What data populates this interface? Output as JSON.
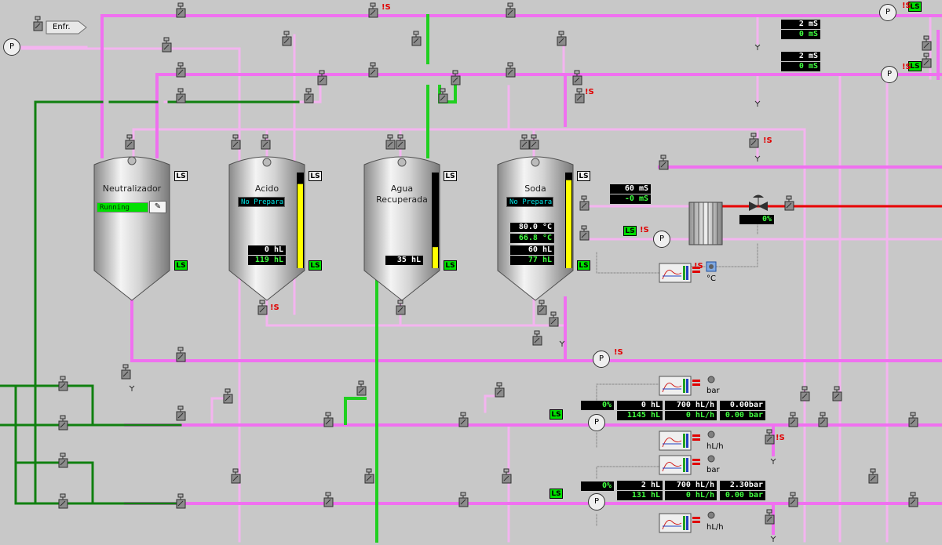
{
  "header": {
    "button_label": "Enfr."
  },
  "tanks": [
    {
      "name": "Neutralizador",
      "status": "Running"
    },
    {
      "name": "Acido",
      "status": "No Prepara",
      "volume": "0 hL",
      "capacity": "119 hL",
      "level": 0.88
    },
    {
      "name": "Agua\nRecuperada",
      "line1": "Agua",
      "line2": "Recuperada",
      "volume": "35 hL",
      "level": 0.22
    },
    {
      "name": "Soda",
      "status": "No Prepara",
      "temp_set": "80.0 °C",
      "temp_actual": "66.8 °C",
      "volume": "60 hL",
      "capacity": "77 hL",
      "level": 0.92
    }
  ],
  "ls_label": "LS",
  "alarm_label": "!S",
  "pump_label": "P",
  "conductivity": {
    "top1_set": "2 mS",
    "top1_actual": "0 mS",
    "top2_set": "2 mS",
    "top2_actual": "0 mS",
    "soda_set": "60 mS",
    "soda_actual": "-0 mS"
  },
  "valve_opening": "0%",
  "temp_unit": "°C",
  "line1": {
    "pump_pct": "0%",
    "volume": "0 hL",
    "volume_total": "1145 hL",
    "flow_set": "700 hL/h",
    "flow_actual": "0 hL/h",
    "pressure_set": "0.00bar",
    "pressure_actual": "0.00 bar",
    "unit_pressure": "bar",
    "unit_flow": "hL/h"
  },
  "line2": {
    "pump_pct": "0%",
    "volume": "2 hL",
    "volume_total": "131 hL",
    "flow_set": "700 hL/h",
    "flow_actual": "0 hL/h",
    "pressure_set": "2.30bar",
    "pressure_actual": "0.00 bar",
    "unit_pressure": "bar",
    "unit_flow": "hL/h"
  },
  "colors": {
    "background": "#c8c8c8",
    "pipe_pink": "#f070f0",
    "pipe_light_pink": "#f4b4f0",
    "pipe_green": "#20d020",
    "pipe_dark_green": "#108010",
    "pipe_red": "#e80000",
    "alarm": "#e00000",
    "ls_active": "#00e000",
    "level_bar": "#ffff00"
  },
  "icons": [
    "pump-icon",
    "valve-icon",
    "heat-exchanger-icon",
    "trend-icon",
    "tank-icon",
    "drain-icon"
  ]
}
